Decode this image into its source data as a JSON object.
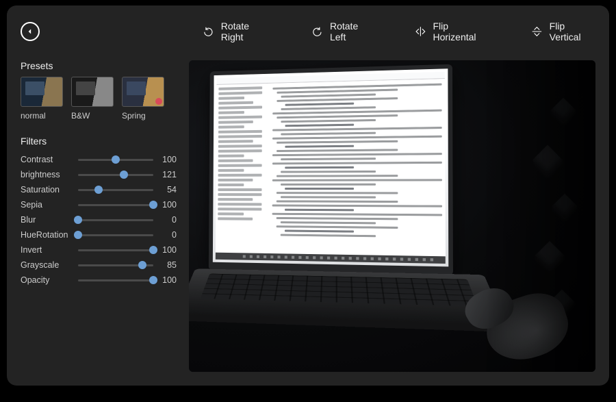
{
  "toolbar": {
    "rotate_right": "Rotate Right",
    "rotate_left": "Rotate Left",
    "flip_horizontal": "Flip Horizental",
    "flip_vertical": "Flip Vertical"
  },
  "sidebar": {
    "presets_title": "Presets",
    "filters_title": "Filters",
    "presets": [
      {
        "label": "normal"
      },
      {
        "label": "B&W"
      },
      {
        "label": "Spring"
      }
    ],
    "filters": [
      {
        "label": "Contrast",
        "value": 100,
        "min": 0,
        "max": 200
      },
      {
        "label": "brightness",
        "value": 121,
        "min": 0,
        "max": 200
      },
      {
        "label": "Saturation",
        "value": 54,
        "min": 0,
        "max": 200
      },
      {
        "label": "Sepia",
        "value": 100,
        "min": 0,
        "max": 100
      },
      {
        "label": "Blur",
        "value": 0,
        "min": 0,
        "max": 100
      },
      {
        "label": "HueRotation",
        "value": 0,
        "min": 0,
        "max": 100
      },
      {
        "label": "Invert",
        "value": 100,
        "min": 0,
        "max": 100
      },
      {
        "label": "Grayscale",
        "value": 85,
        "min": 0,
        "max": 100
      },
      {
        "label": "Opacity",
        "value": 100,
        "min": 0,
        "max": 100
      }
    ]
  }
}
